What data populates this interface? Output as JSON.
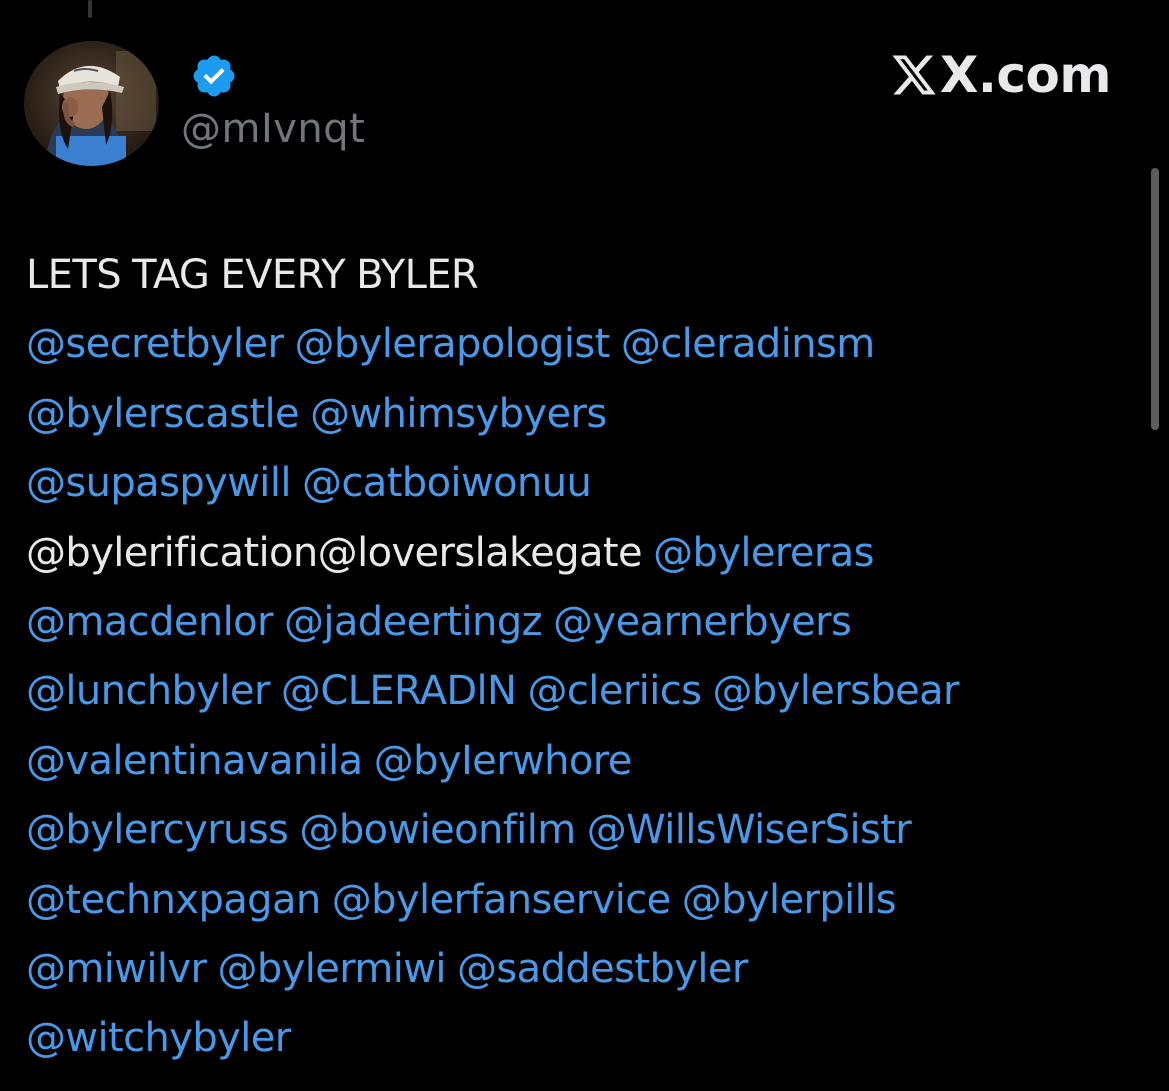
{
  "post": {
    "handle": "@mIvnqt",
    "brand_label": "X.com",
    "text_intro": "LETS TAG EVERY BYLER",
    "lines": [
      [
        {
          "text": "@secretbyler",
          "kind": "mention"
        },
        {
          "text": " ",
          "kind": "plain"
        },
        {
          "text": "@bylerapologist",
          "kind": "mention"
        },
        {
          "text": " ",
          "kind": "plain"
        },
        {
          "text": "@cleradinsm",
          "kind": "mention"
        }
      ],
      [
        {
          "text": "@bylerscastle",
          "kind": "mention"
        },
        {
          "text": " ",
          "kind": "plain"
        },
        {
          "text": "@whimsybyers",
          "kind": "mention"
        }
      ],
      [
        {
          "text": "@supaspywill",
          "kind": "mention"
        },
        {
          "text": " ",
          "kind": "plain"
        },
        {
          "text": "@catboiwonuu",
          "kind": "mention"
        }
      ],
      [
        {
          "text": "@bylerification@loverslakegate",
          "kind": "plain"
        },
        {
          "text": " ",
          "kind": "plain"
        },
        {
          "text": "@bylereras",
          "kind": "mention"
        }
      ],
      [
        {
          "text": "@macdenlor",
          "kind": "mention"
        },
        {
          "text": " ",
          "kind": "plain"
        },
        {
          "text": "@jadeertingz",
          "kind": "mention"
        },
        {
          "text": " ",
          "kind": "plain"
        },
        {
          "text": "@yearnerbyers",
          "kind": "mention"
        }
      ],
      [
        {
          "text": "@lunchbyler",
          "kind": "mention"
        },
        {
          "text": " ",
          "kind": "plain"
        },
        {
          "text": "@CLERADlN",
          "kind": "mention"
        },
        {
          "text": " ",
          "kind": "plain"
        },
        {
          "text": "@cleriics",
          "kind": "mention"
        },
        {
          "text": " ",
          "kind": "plain"
        },
        {
          "text": "@bylersbear",
          "kind": "mention"
        }
      ],
      [
        {
          "text": "@valentinavanila",
          "kind": "mention"
        },
        {
          "text": " ",
          "kind": "plain"
        },
        {
          "text": "@byIerwhore",
          "kind": "mention"
        }
      ],
      [
        {
          "text": "@bylercyruss",
          "kind": "mention"
        },
        {
          "text": " ",
          "kind": "plain"
        },
        {
          "text": "@bowieonfilm",
          "kind": "mention"
        },
        {
          "text": " ",
          "kind": "plain"
        },
        {
          "text": "@WillsWiserSistr",
          "kind": "mention"
        }
      ],
      [
        {
          "text": "@technxpagan",
          "kind": "mention"
        },
        {
          "text": " ",
          "kind": "plain"
        },
        {
          "text": "@bylerfanservice",
          "kind": "mention"
        },
        {
          "text": " ",
          "kind": "plain"
        },
        {
          "text": "@bylerpills",
          "kind": "mention"
        }
      ],
      [
        {
          "text": "@miwilvr",
          "kind": "mention"
        },
        {
          "text": " ",
          "kind": "plain"
        },
        {
          "text": "@bylermiwi",
          "kind": "mention"
        },
        {
          "text": " ",
          "kind": "plain"
        },
        {
          "text": "@saddestbyler",
          "kind": "mention"
        }
      ],
      [
        {
          "text": "@witchybyler",
          "kind": "mention"
        }
      ]
    ]
  },
  "icons": {
    "avatar": "profile-photo",
    "verified": "verified-badge-icon",
    "brand": "x-logo-icon"
  },
  "colors": {
    "background": "#000000",
    "text": "#e7e9ea",
    "mention": "#4a99e9",
    "handle": "#71767b",
    "verified": "#1d9bf0"
  }
}
